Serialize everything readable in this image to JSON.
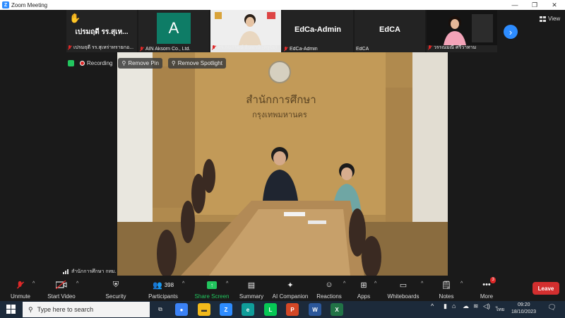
{
  "window": {
    "title": "Zoom Meeting",
    "minimize": "—",
    "restore": "❐",
    "close": "✕"
  },
  "strip": {
    "tiles": [
      {
        "big": "เปรมฤดี  รร.สุเห...",
        "name": "เปรมฤดี  รร.สุเหร่าทรายกอ..."
      },
      {
        "big": "A",
        "name": "AIN Aksorn Co., Ltd."
      },
      {
        "big": "",
        "name": "ทร.กนกรัตน์ อินพานี (ครูโม)"
      },
      {
        "big": "EdCa-Admin",
        "name": "EdCa-Admin"
      },
      {
        "big": "EdCA",
        "name": "EdCA"
      },
      {
        "big": "",
        "name": "วรรณมณี ศรีวาทาม"
      }
    ],
    "next_icon": "chevron-right-icon",
    "view_label": "View"
  },
  "status": {
    "recording_label": "Recording",
    "remove_pin": "Remove Pin",
    "remove_spotlight": "Remove Spotlight"
  },
  "video": {
    "sign_line1": "สำนักการศึกษา",
    "sign_line2": "กรุงเทพมหานคร",
    "caption": "สำนักการศึกษา กทม."
  },
  "toolbar": {
    "unmute": "Unmute",
    "start_video": "Start Video",
    "security": "Security",
    "participants": "Participants",
    "participants_count": "398",
    "share_screen": "Share Screen",
    "summary": "Summary",
    "ai_companion": "AI Companion",
    "reactions": "Reactions",
    "apps": "Apps",
    "whiteboards": "Whiteboards",
    "notes": "Notes",
    "more": "More",
    "more_badge": "3",
    "leave": "Leave"
  },
  "taskbar": {
    "search_placeholder": "Type here to search",
    "lang": "ไทย",
    "time": "09:20",
    "date": "18/10/2023",
    "ppt_badge": "P"
  },
  "colors": {
    "accent": "#2d8cff",
    "leave": "#d32f2f",
    "share": "#22c55e",
    "taskbar": "#1c2a3a"
  }
}
